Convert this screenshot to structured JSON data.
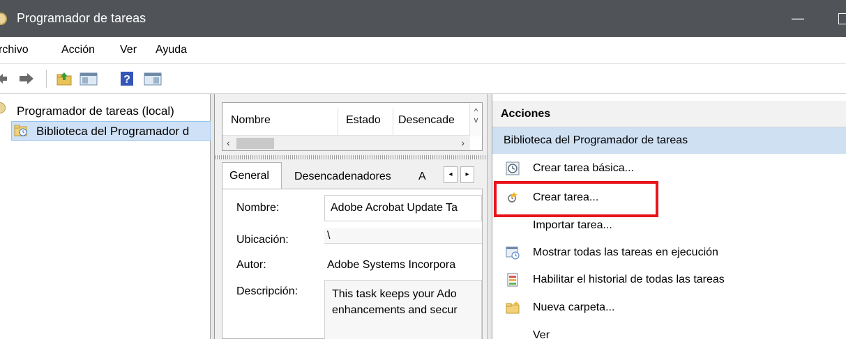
{
  "window": {
    "title": "Programador de tareas"
  },
  "menu": [
    "rchivo",
    "Acción",
    "Ver",
    "Ayuda"
  ],
  "tree": {
    "root": "Programador de tareas (local)",
    "child": "Biblioteca del Programador d"
  },
  "list": {
    "columns": [
      "Nombre",
      "Estado",
      "Desencade"
    ]
  },
  "tabs": [
    "General",
    "Desencadenadores",
    "A"
  ],
  "general": {
    "name_label": "Nombre:",
    "name_value": "Adobe Acrobat Update Ta",
    "location_label": "Ubicación:",
    "location_value": "\\",
    "author_label": "Autor:",
    "author_value": "Adobe Systems Incorpora",
    "description_label": "Descripción:",
    "description_line1": "This task keeps your Ado",
    "description_line2": "enhancements and secur"
  },
  "actions": {
    "header": "Acciones",
    "section": "Biblioteca del Programador de tareas",
    "items": [
      "Crear tarea básica...",
      "Crear tarea...",
      "Importar tarea...",
      "Mostrar todas las tareas en ejecución",
      "Habilitar el historial de todas las tareas",
      "Nueva carpeta...",
      "Ver"
    ]
  },
  "icons": {
    "app": "task-scheduler-icon",
    "back": "back-arrow-icon",
    "forward": "forward-arrow-icon",
    "up": "folder-up-icon",
    "show_hide_tree": "console-tree-icon",
    "help": "help-icon",
    "show_hide_actions": "action-pane-icon"
  },
  "colors": {
    "titlebar": "#505357",
    "selection": "#cfe0f3",
    "highlight": "#e8141c"
  }
}
